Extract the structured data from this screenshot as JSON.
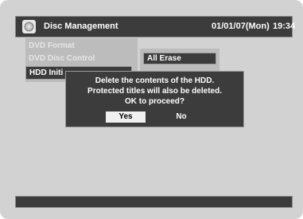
{
  "header": {
    "title": "Disc Management",
    "date": "01/01/07(Mon)",
    "time": "19:34",
    "icon": "disc-icon"
  },
  "menu": {
    "items": [
      {
        "label": "DVD Format",
        "selected": false
      },
      {
        "label": "DVD Disc Control",
        "selected": false
      },
      {
        "label": "HDD Initi",
        "selected": true
      }
    ]
  },
  "submenu": {
    "items": [
      {
        "label": "All Erase"
      }
    ]
  },
  "dialog": {
    "lines": [
      "Delete the contents of the HDD.",
      "Protected titles will also be deleted.",
      "OK to proceed?"
    ],
    "yes_label": "Yes",
    "no_label": "No",
    "selected": "Yes"
  },
  "colors": {
    "background": "#d2d2d2",
    "bar": "#3c3c3c",
    "highlight": "#f0f0f0"
  }
}
